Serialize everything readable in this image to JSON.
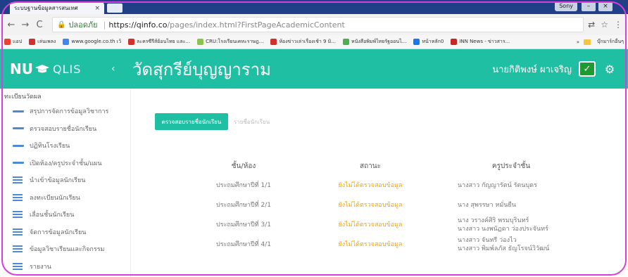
{
  "browser": {
    "tab_title": "ระบบฐานข้อมูลสารสนเทศ",
    "tab_close": "×",
    "profile_name": "Sony",
    "window_minimize": "–",
    "window_close": "×",
    "back": "←",
    "forward": "→",
    "reload": "C",
    "security_label": "ปลอดภัย",
    "url_host": "https://qinfo.co",
    "url_path": "/pages/index.html?FirstPageAcademicContent",
    "translate_icon": "⇄",
    "star_icon": "☆",
    "menu_icon": "⋮"
  },
  "bookmarks": {
    "items": [
      {
        "label": "แอป",
        "color": "#ea4335"
      },
      {
        "label": "เล่นเพลง",
        "color": "#d32f2f"
      },
      {
        "label": "www.google.co.th เว้",
        "color": "#4285f4"
      },
      {
        "label": "ละครซีรีส์ย้อนไทย และ...",
        "color": "#d32f2f"
      },
      {
        "label": "CRU:โรงเรียนเคหะราษฎ...",
        "color": "#8bc34a"
      },
      {
        "label": "ห้องข่าวเล่าเรื่องเช้า 9 มิ...",
        "color": "#d32f2f"
      },
      {
        "label": "หนังสือพิมพ์ไทยรัฐออนไ...",
        "color": "#4caf50"
      },
      {
        "label": "หน้าหลัก0",
        "color": "#1877f2"
      },
      {
        "label": "INN News - ข่าวสาร...",
        "color": "#c62828"
      }
    ],
    "more": "»",
    "other_folder": "บุ๊กมาร์กอื่นๆ"
  },
  "header": {
    "logo_nu": "NU",
    "logo_qlis": "QLIS",
    "collapse": "‹",
    "title": "วัดสุกรีย์บุญญาราม",
    "user_name": "นายกิติพงษ์ ผาเจริญ",
    "check_icon": "✓",
    "gear_icon": "⚙"
  },
  "sidebar": {
    "title": "ทะเบียนวัดผล",
    "items": [
      {
        "label": "สรุปการจัดการข้อมูลวิชาการ",
        "icon": "dash"
      },
      {
        "label": "ตรวจสอบรายชื่อนักเรียน",
        "icon": "dash"
      },
      {
        "label": "ปฏิทินโรงเรียน",
        "icon": "dash"
      },
      {
        "label": "เปิดห้อง/ครูประจำชั้น/แผน",
        "icon": "dash"
      },
      {
        "label": "นำเข้าข้อมูลนักเรียน",
        "icon": "lines"
      },
      {
        "label": "ลงทะเบียนนักเรียน",
        "icon": "lines"
      },
      {
        "label": "เลื่อนชั้นนักเรียน",
        "icon": "lines"
      },
      {
        "label": "จัดการข้อมูลนักเรียน",
        "icon": "lines"
      },
      {
        "label": "ข้อมูลวิชาเรียนและกิจกรรม",
        "icon": "lines"
      },
      {
        "label": "รายงาน",
        "icon": "lines"
      }
    ]
  },
  "main": {
    "verify_button": "ตรวจสอบรายชื่อนักเรียน",
    "names_button": "รายชื่อนักเรียน",
    "table": {
      "headers": [
        "ชั้น/ห้อง",
        "สถานะ",
        "ครูประจำชั้น"
      ],
      "rows": [
        {
          "class": "ประถมศึกษาปีที่ 1/1",
          "status": "ยังไม่ได้ตรวจสอบข้อมูล",
          "teachers": [
            "นางสาว กัญญารัตน์ รัตนบุตร"
          ]
        },
        {
          "class": "ประถมศึกษาปีที่ 2/1",
          "status": "ยังไม่ได้ตรวจสอบข้อมูล",
          "teachers": [
            "นาง สุพรรษา หมั่นยืน"
          ]
        },
        {
          "class": "ประถมศึกษาปีที่ 3/1",
          "status": "ยังไม่ได้ตรวจสอบข้อมูล",
          "teachers": [
            "นาง วรางค์ศิริ พรมบุรินทร์",
            "นางสาว นงพนัฏดา ว่องประจันทร์"
          ]
        },
        {
          "class": "ประถมศึกษาปีที่ 4/1",
          "status": "ยังไม่ได้ตรวจสอบข้อมูล",
          "teachers": [
            "นางสาว จันทรี ว่องไว",
            "นางสาว พิมพ์ลภัส ธัญโรจน์วิวัฒน์"
          ]
        }
      ]
    }
  },
  "colors": {
    "header_teal": "#1fbfa4",
    "status_orange": "#f0a500",
    "sidebar_blue": "#4c8ad6",
    "check_green": "#1e9a33",
    "frame_magenta": "#d63ee0"
  }
}
